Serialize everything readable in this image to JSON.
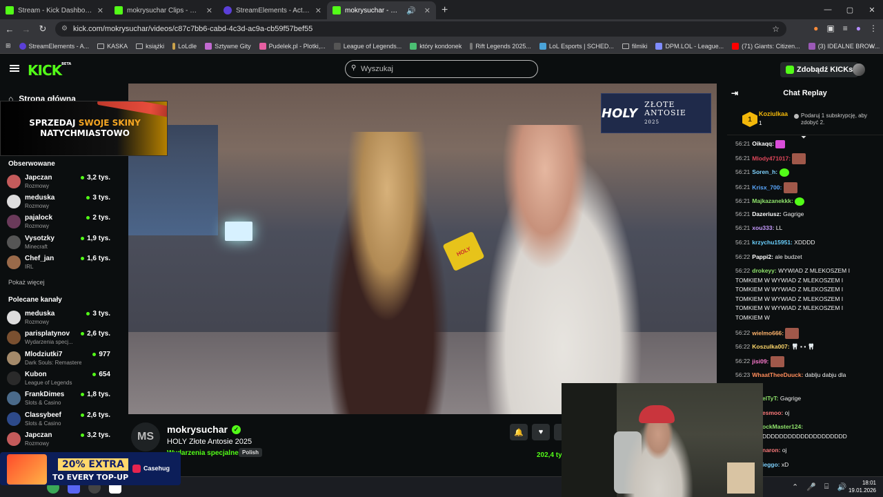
{
  "browser": {
    "tabs": [
      {
        "title": "Stream - Kick Dashboard",
        "color": "#53fc18"
      },
      {
        "title": "mokrysuchar Clips - Watch Live",
        "color": "#53fc18"
      },
      {
        "title": "StreamElements - Activity feed",
        "color": "#5b3fd8"
      },
      {
        "title": "mokrysuchar - Watch the V",
        "color": "#53fc18"
      }
    ],
    "url": "kick.com/mokrysuchar/videos/c87c7bb6-cabd-4c3d-ac9a-cb59f57bef55",
    "bookmarks": [
      "StreamElements - A...",
      "KASKA",
      "książki",
      "LoLdle",
      "Sztywne Gity",
      "Pudelek.pl - Plotki,...",
      "League of Legends...",
      "który kondonek",
      "Rift Legends 2025...",
      "LoL Esports | SCHED...",
      "filmiki",
      "DPM.LOL - League...",
      "(71) Giants: Citizen...",
      "(3) IDEALNE BROW..."
    ]
  },
  "header": {
    "logo": "KICK",
    "logo_sup": "BETA",
    "search_placeholder": "Wyszukaj",
    "get_kicks": "Zdobądź KICKs"
  },
  "sidebar": {
    "home": "Strona główna",
    "promo_line1": "SPRZEDAJ ",
    "promo_highlight": "SWOJE SKINY",
    "promo_line2": "NATYCHMIASTOWO",
    "followed_title": "Obserwowane",
    "followed": [
      {
        "name": "Japczan",
        "category": "Rozmowy",
        "viewers": "3,2 tys."
      },
      {
        "name": "meduska",
        "category": "Rozmowy",
        "viewers": "3 tys."
      },
      {
        "name": "pajalock",
        "category": "Rozmowy",
        "viewers": "2 tys."
      },
      {
        "name": "Vysotzky",
        "category": "Minecraft",
        "viewers": "1,9 tys."
      },
      {
        "name": "Chef_jan",
        "category": "IRL",
        "viewers": "1,6 tys."
      }
    ],
    "show_more": "Pokaż więcej",
    "recommended_title": "Polecane kanały",
    "recommended": [
      {
        "name": "meduska",
        "category": "Rozmowy",
        "viewers": "3 tys."
      },
      {
        "name": "parisplatynov",
        "category": "Wydarzenia specj...",
        "viewers": "2,6 tys."
      },
      {
        "name": "Mlodziutki7",
        "category": "Dark Souls: Remastered",
        "viewers": "977"
      },
      {
        "name": "Kubon",
        "category": "League of Legends",
        "viewers": "654"
      },
      {
        "name": "FrankDimes",
        "category": "Slots & Casino",
        "viewers": "1,8 tys."
      },
      {
        "name": "Classybeef",
        "category": "Slots & Casino",
        "viewers": "2,6 tys."
      },
      {
        "name": "Japczan",
        "category": "Rozmowy",
        "viewers": "3,2 tys."
      }
    ]
  },
  "video": {
    "overlay_brand": "HOLY",
    "overlay_title": "ZŁOTE ANTOSIE",
    "overlay_year": "2025",
    "mic_label": "HOLY"
  },
  "info": {
    "avatar_initials": "MS",
    "streamer": "mokrysuchar",
    "title": "HOLY Złote Antosie 2025",
    "category": "Wydarzenia specjalne",
    "language": "Polish",
    "views": "202,4 ty"
  },
  "chat": {
    "title": "Chat Replay",
    "leader_name": "Koziulkaa",
    "leader_rank": "1",
    "leader_count": "1",
    "leader_hint": "Podaruj 1 subskrypcję, aby zdobyć 2.",
    "messages": [
      {
        "time": "56:21",
        "user": "Oikaqq:",
        "color": "#ffffff",
        "text": ""
      },
      {
        "time": "56:21",
        "user": "Mlody471017:",
        "color": "#e0475b",
        "text": ""
      },
      {
        "time": "56:21",
        "user": "Soren_h:",
        "color": "#7fd3ff",
        "text": ""
      },
      {
        "time": "56:21",
        "user": "Krisx_700:",
        "color": "#5aa8ff",
        "text": ""
      },
      {
        "time": "56:21",
        "user": "Majkazanekkk:",
        "color": "#8fe36b",
        "text": ""
      },
      {
        "time": "56:21",
        "user": "Dazeriusz:",
        "color": "#ffffff",
        "text": "Gagrige"
      },
      {
        "time": "56:21",
        "user": "xou333:",
        "color": "#c79bff",
        "text": "LL"
      },
      {
        "time": "56:21",
        "user": "krzychu15951:",
        "color": "#6bd1ff",
        "text": "XDDDD"
      },
      {
        "time": "56:22",
        "user": "Pappi2:",
        "color": "#ffffff",
        "text": "ale budzet"
      },
      {
        "time": "56:22",
        "user": "drokeyy:",
        "color": "#8fe36b",
        "text": "WYWIAD Z MLEKOSZEM I TOMKIEM W WYWIAD Z MLEKOSZEM I TOMKIEM W WYWIAD Z MLEKOSZEM I TOMKIEM W WYWIAD Z MLEKOSZEM I TOMKIEM W WYWIAD Z MLEKOSZEM I TOMKIEM W"
      },
      {
        "time": "56:22",
        "user": "wielmo666:",
        "color": "#ffb36b",
        "text": ""
      },
      {
        "time": "56:22",
        "user": "Koszulka007:",
        "color": "#ffd86b",
        "text": ""
      },
      {
        "time": "56:22",
        "user": "jisi09:",
        "color": "#ff7bd0",
        "text": ""
      },
      {
        "time": "56:23",
        "user": "WhaatTheeDuuck:",
        "color": "#ff8c5a",
        "text": "dablju dabju dla"
      }
    ]
  },
  "catchup": [
    {
      "user": "elTyT:",
      "color": "#8fe36b",
      "text": "Gagrige"
    },
    {
      "user": "esmoo:",
      "color": "#ff7b7b",
      "text": "oj"
    },
    {
      "user": "ockMaster124:",
      "color": "#8fe36b",
      "text": "DDDDDDDDDDDDDDDDDDDD"
    },
    {
      "user": "naron:",
      "color": "#ff7b7b",
      "text": "oj"
    },
    {
      "user": "ieggo:",
      "color": "#7fd3ff",
      "text": "xD"
    }
  ],
  "ad": {
    "headline": "20% EXTRA",
    "sub": "TO EVERY TOP-UP",
    "brand": "Casehug"
  },
  "taskbar": {
    "time": "18:01",
    "date": "19.01.2026"
  }
}
